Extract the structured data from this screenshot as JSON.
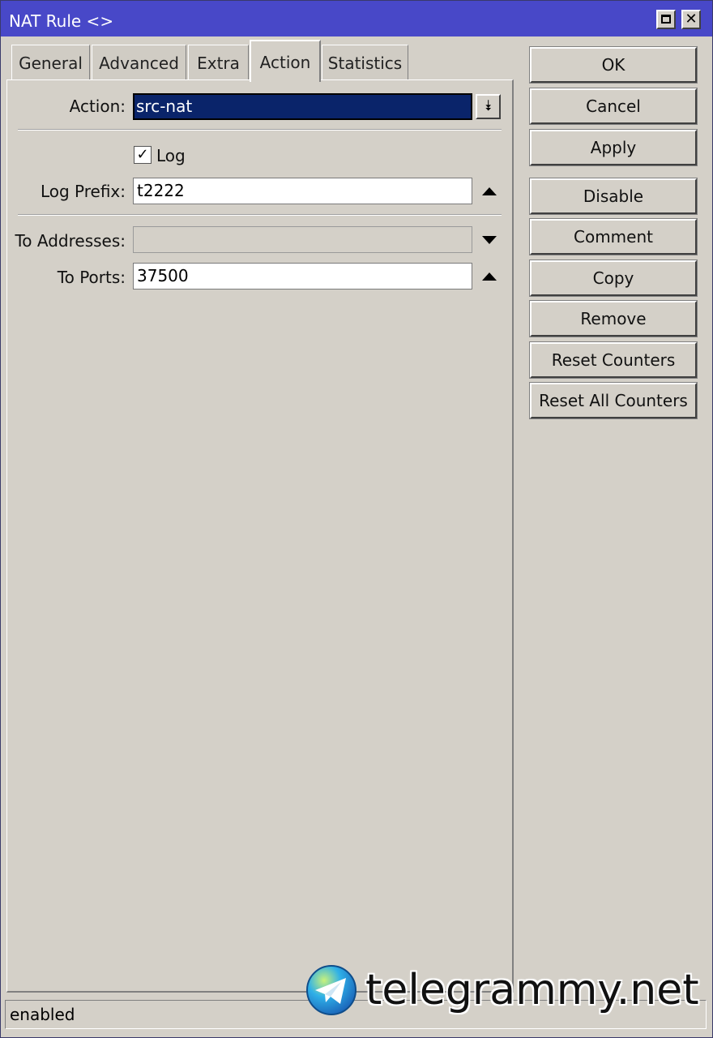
{
  "window": {
    "title": "NAT Rule <>"
  },
  "tabs": [
    {
      "label": "General"
    },
    {
      "label": "Advanced"
    },
    {
      "label": "Extra"
    },
    {
      "label": "Action"
    },
    {
      "label": "Statistics"
    }
  ],
  "form": {
    "action": {
      "label": "Action:",
      "value": "src-nat"
    },
    "log": {
      "label": "Log",
      "checked": true
    },
    "log_prefix": {
      "label": "Log Prefix:",
      "value": "t2222"
    },
    "to_addresses": {
      "label": "To Addresses:",
      "value": ""
    },
    "to_ports": {
      "label": "To Ports:",
      "value": "37500"
    }
  },
  "buttons": {
    "ok": "OK",
    "cancel": "Cancel",
    "apply": "Apply",
    "disable": "Disable",
    "comment": "Comment",
    "copy": "Copy",
    "remove": "Remove",
    "reset_counters": "Reset Counters",
    "reset_all_counters": "Reset All Counters"
  },
  "status": {
    "text": "enabled"
  },
  "watermark": {
    "text": "telegrammy.net"
  },
  "colors": {
    "titlebar": "#4848c8",
    "selection": "#0a246a",
    "face": "#d4d0c8"
  }
}
